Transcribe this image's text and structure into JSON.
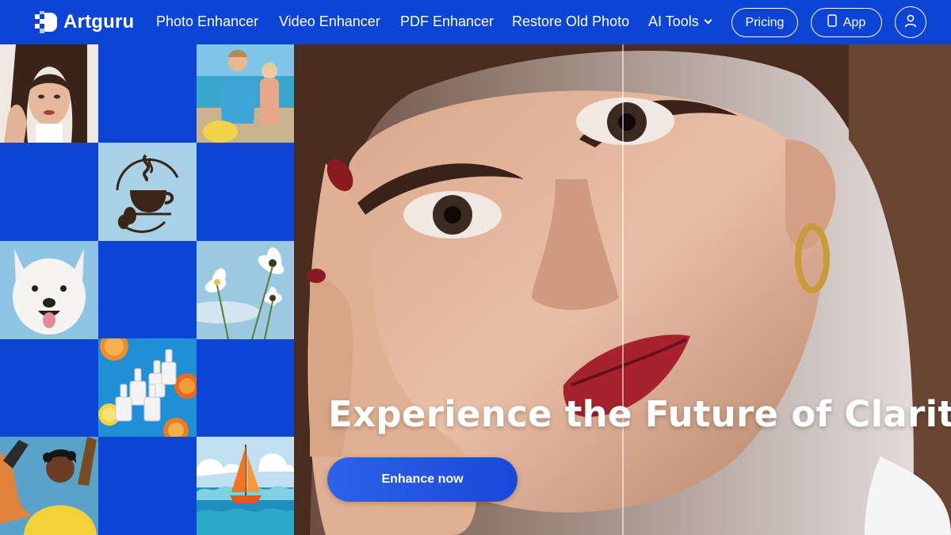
{
  "brand": {
    "name": "Artguru"
  },
  "nav": {
    "photo_enhancer": "Photo Enhancer",
    "video_enhancer": "Video Enhancer",
    "pdf_enhancer": "PDF Enhancer",
    "restore_old_photo": "Restore Old Photo",
    "ai_tools": "AI Tools"
  },
  "actions": {
    "pricing": "Pricing",
    "app": "App"
  },
  "icons": [
    "logo-icon",
    "chevron-down-icon",
    "phone-icon",
    "user-icon"
  ],
  "hero": {
    "headline": "Experience the Future of Clarity",
    "cta": "Enhance now"
  },
  "colors": {
    "brand_blue": "#0b44d6",
    "cta_blue": "#2d62e8",
    "text": "#ffffff"
  }
}
